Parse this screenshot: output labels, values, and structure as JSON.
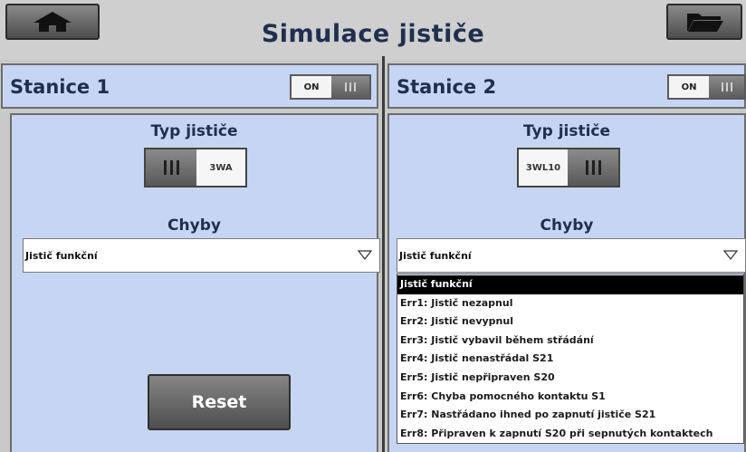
{
  "header": {
    "title": "Simulace jističe",
    "home_icon": "home-icon",
    "folder_icon": "folder-icon"
  },
  "stations": [
    {
      "name": "Stanice 1",
      "power_label": "ON",
      "breaker_type_label": "Typ jističe",
      "breaker_type_value": "3WA",
      "errors_label": "Chyby",
      "selected_error": "Jistič funkční",
      "reset_label": "Reset"
    },
    {
      "name": "Stanice 2",
      "power_label": "ON",
      "breaker_type_label": "Typ jističe",
      "breaker_type_value": "3WL10",
      "errors_label": "Chyby",
      "selected_error": "Jistič funkční",
      "error_options": [
        "Jistič funkční",
        "Err1: Jistič nezapnul",
        "Err2: Jistič nevypnul",
        "Err3: Jistič vybavil během střádání",
        "Err4: Jistič nenastřádal S21",
        "Err5: Jistič nepřipraven S20",
        "Err6: Chyba pomocného kontaktu S1",
        "Err7: Nastřádano ihned po zapnutí jističe S21",
        "Err8: Připraven k zapnutí S20 při sepnutých kontaktech"
      ]
    }
  ],
  "colors": {
    "panel_bg": "#c6d5f2",
    "title_text": "#1f2f4f",
    "window_bg": "#c9c9c9"
  }
}
